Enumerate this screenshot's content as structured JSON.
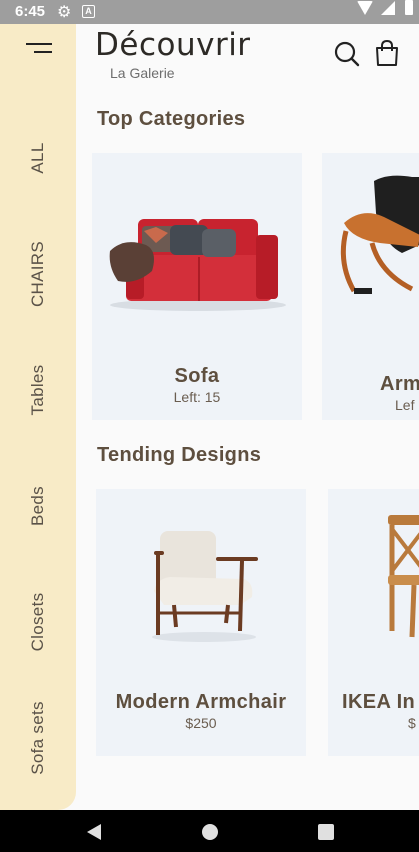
{
  "status": {
    "time": "6:45",
    "gear_icon": "gear-icon",
    "a_icon": "A"
  },
  "sidebar": {
    "menu_icon": "menu-icon",
    "items": [
      {
        "label": "ALL"
      },
      {
        "label": "CHAIRS"
      },
      {
        "label": "Tables"
      },
      {
        "label": "Beds"
      },
      {
        "label": "Closets"
      },
      {
        "label": "Sofa sets"
      }
    ]
  },
  "header": {
    "title": "Découvrir",
    "subtitle": "La Galerie",
    "search_icon": "search-icon",
    "cart_icon": "shopping-bag-icon"
  },
  "top_categories": {
    "title": "Top Categories",
    "cards": [
      {
        "name": "Sofa",
        "sub": "Left: 15",
        "image": "red-sofa-image"
      },
      {
        "name": "Arm",
        "sub": "Lef",
        "image": "lounge-chair-image"
      }
    ]
  },
  "trending": {
    "title": "Tending Designs",
    "cards": [
      {
        "name": "Modern Armchair",
        "sub": "$250",
        "image": "armchair-image"
      },
      {
        "name": "IKEA In",
        "sub": "$",
        "image": "wooden-chair-image"
      }
    ]
  },
  "nav": {
    "back_icon": "back-icon",
    "home_icon": "home-icon",
    "recent_icon": "recent-apps-icon"
  },
  "colors": {
    "sidebar_bg": "#f8ebc7",
    "card_bg": "#eff3f8",
    "heading": "#5e4f3f",
    "sofa": "#d32f3a"
  }
}
